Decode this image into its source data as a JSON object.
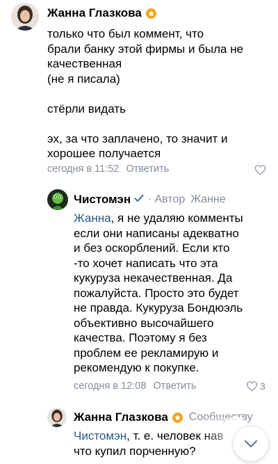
{
  "comments": [
    {
      "author": "Жанна Глазкова",
      "text": "только что был коммент, что\nбрали банку этой фирмы и была не\nкачественная\n(не я писала)\n\nстёрли  видать\n\nэх, за что заплачено, то значит и\nхорошее получается",
      "time": "сегодня в 11:52",
      "reply_label": "Ответить",
      "likes": ""
    },
    {
      "author": "Чистомэн",
      "role": "Автор",
      "reply_to": "Жанне",
      "mention": "Жанна",
      "text": ", я не удаляю комменты\nесли они написаны адекватно\nи без оскорблений. Если кто\n-то хочет написать что эта\nкукуруза некачественная. Да\nпожалуйста. Просто это будет\nне правда. Кукуруза Бондюэль\nобъективно высочайшего\nкачества. Поэтому я без\nпроблем ее рекламирую и\nрекомендую к покупке.",
      "time": "сегодня в 12:08",
      "reply_label": "Ответить",
      "likes": "3"
    },
    {
      "author": "Жанна Глазкова",
      "reply_to": "Сообществу",
      "mention": "Чистомэн",
      "text": ", т. е. человек нав\nчто купил порченную?"
    }
  ],
  "icons": {
    "like": "heart-outline-icon",
    "scroll_down": "chevron-down-icon",
    "verified": "checkmark-icon",
    "badge": "star-badge-icon"
  },
  "colors": {
    "link": "#2a5885",
    "meta": "#818c99",
    "badge": "#f1a51b",
    "verified": "#4a76a8"
  }
}
